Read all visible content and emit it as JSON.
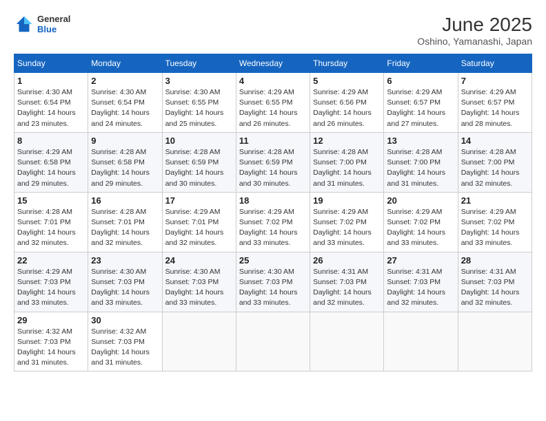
{
  "header": {
    "logo": {
      "general": "General",
      "blue": "Blue"
    },
    "title": "June 2025",
    "location": "Oshino, Yamanashi, Japan"
  },
  "calendar": {
    "days_of_week": [
      "Sunday",
      "Monday",
      "Tuesday",
      "Wednesday",
      "Thursday",
      "Friday",
      "Saturday"
    ],
    "weeks": [
      [
        {
          "day": "1",
          "sunrise": "4:30 AM",
          "sunset": "6:54 PM",
          "daylight": "14 hours and 23 minutes."
        },
        {
          "day": "2",
          "sunrise": "4:30 AM",
          "sunset": "6:54 PM",
          "daylight": "14 hours and 24 minutes."
        },
        {
          "day": "3",
          "sunrise": "4:30 AM",
          "sunset": "6:55 PM",
          "daylight": "14 hours and 25 minutes."
        },
        {
          "day": "4",
          "sunrise": "4:29 AM",
          "sunset": "6:55 PM",
          "daylight": "14 hours and 26 minutes."
        },
        {
          "day": "5",
          "sunrise": "4:29 AM",
          "sunset": "6:56 PM",
          "daylight": "14 hours and 26 minutes."
        },
        {
          "day": "6",
          "sunrise": "4:29 AM",
          "sunset": "6:57 PM",
          "daylight": "14 hours and 27 minutes."
        },
        {
          "day": "7",
          "sunrise": "4:29 AM",
          "sunset": "6:57 PM",
          "daylight": "14 hours and 28 minutes."
        }
      ],
      [
        {
          "day": "8",
          "sunrise": "4:29 AM",
          "sunset": "6:58 PM",
          "daylight": "14 hours and 29 minutes."
        },
        {
          "day": "9",
          "sunrise": "4:28 AM",
          "sunset": "6:58 PM",
          "daylight": "14 hours and 29 minutes."
        },
        {
          "day": "10",
          "sunrise": "4:28 AM",
          "sunset": "6:59 PM",
          "daylight": "14 hours and 30 minutes."
        },
        {
          "day": "11",
          "sunrise": "4:28 AM",
          "sunset": "6:59 PM",
          "daylight": "14 hours and 30 minutes."
        },
        {
          "day": "12",
          "sunrise": "4:28 AM",
          "sunset": "7:00 PM",
          "daylight": "14 hours and 31 minutes."
        },
        {
          "day": "13",
          "sunrise": "4:28 AM",
          "sunset": "7:00 PM",
          "daylight": "14 hours and 31 minutes."
        },
        {
          "day": "14",
          "sunrise": "4:28 AM",
          "sunset": "7:00 PM",
          "daylight": "14 hours and 32 minutes."
        }
      ],
      [
        {
          "day": "15",
          "sunrise": "4:28 AM",
          "sunset": "7:01 PM",
          "daylight": "14 hours and 32 minutes."
        },
        {
          "day": "16",
          "sunrise": "4:28 AM",
          "sunset": "7:01 PM",
          "daylight": "14 hours and 32 minutes."
        },
        {
          "day": "17",
          "sunrise": "4:29 AM",
          "sunset": "7:01 PM",
          "daylight": "14 hours and 32 minutes."
        },
        {
          "day": "18",
          "sunrise": "4:29 AM",
          "sunset": "7:02 PM",
          "daylight": "14 hours and 33 minutes."
        },
        {
          "day": "19",
          "sunrise": "4:29 AM",
          "sunset": "7:02 PM",
          "daylight": "14 hours and 33 minutes."
        },
        {
          "day": "20",
          "sunrise": "4:29 AM",
          "sunset": "7:02 PM",
          "daylight": "14 hours and 33 minutes."
        },
        {
          "day": "21",
          "sunrise": "4:29 AM",
          "sunset": "7:02 PM",
          "daylight": "14 hours and 33 minutes."
        }
      ],
      [
        {
          "day": "22",
          "sunrise": "4:29 AM",
          "sunset": "7:03 PM",
          "daylight": "14 hours and 33 minutes."
        },
        {
          "day": "23",
          "sunrise": "4:30 AM",
          "sunset": "7:03 PM",
          "daylight": "14 hours and 33 minutes."
        },
        {
          "day": "24",
          "sunrise": "4:30 AM",
          "sunset": "7:03 PM",
          "daylight": "14 hours and 33 minutes."
        },
        {
          "day": "25",
          "sunrise": "4:30 AM",
          "sunset": "7:03 PM",
          "daylight": "14 hours and 33 minutes."
        },
        {
          "day": "26",
          "sunrise": "4:31 AM",
          "sunset": "7:03 PM",
          "daylight": "14 hours and 32 minutes."
        },
        {
          "day": "27",
          "sunrise": "4:31 AM",
          "sunset": "7:03 PM",
          "daylight": "14 hours and 32 minutes."
        },
        {
          "day": "28",
          "sunrise": "4:31 AM",
          "sunset": "7:03 PM",
          "daylight": "14 hours and 32 minutes."
        }
      ],
      [
        {
          "day": "29",
          "sunrise": "4:32 AM",
          "sunset": "7:03 PM",
          "daylight": "14 hours and 31 minutes."
        },
        {
          "day": "30",
          "sunrise": "4:32 AM",
          "sunset": "7:03 PM",
          "daylight": "14 hours and 31 minutes."
        },
        null,
        null,
        null,
        null,
        null
      ]
    ]
  }
}
